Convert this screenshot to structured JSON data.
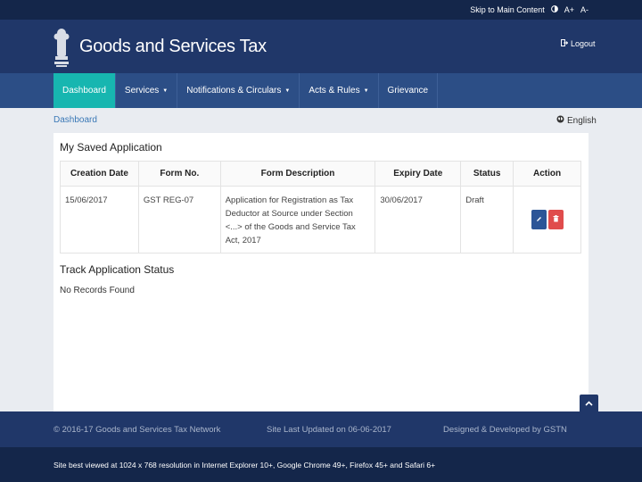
{
  "top_bar": {
    "skip_link": "Skip to Main Content",
    "contrast_icon": "contrast-icon",
    "font_increase": "A+",
    "font_decrease": "A-"
  },
  "header": {
    "title": "Goods and Services Tax",
    "logout_label": "Logout",
    "logout_icon": "logout-icon"
  },
  "nav": {
    "items": [
      {
        "label": "Dashboard",
        "active": true
      },
      {
        "label": "Services",
        "dropdown": true
      },
      {
        "label": "Notifications & Circulars",
        "dropdown": true
      },
      {
        "label": "Acts & Rules",
        "dropdown": true
      },
      {
        "label": "Grievance"
      }
    ]
  },
  "breadcrumb": {
    "label": "Dashboard"
  },
  "language": {
    "label": "English",
    "icon": "globe-icon"
  },
  "saved_application": {
    "title": "My Saved Application",
    "columns": [
      "Creation Date",
      "Form No.",
      "Form Description",
      "Expiry Date",
      "Status",
      "Action"
    ],
    "rows": [
      {
        "creation_date": "15/06/2017",
        "form_no": "GST REG-07",
        "form_description": "Application for Registration as Tax Deductor at Source under Section <...> of the Goods and Service Tax Act, 2017",
        "expiry_date": "30/06/2017",
        "status": "Draft"
      }
    ]
  },
  "track_status": {
    "title": "Track Application Status",
    "empty_text": "No Records Found"
  },
  "footer": {
    "copyright": "© 2016-17 Goods and Services Tax Network",
    "last_updated": "Site Last Updated on 06-06-2017",
    "designed_by": "Designed & Developed by GSTN",
    "best_viewed": "Site best viewed at 1024 x 768 resolution in Internet Explorer 10+, Google Chrome 49+, Firefox 45+ and Safari 6+"
  },
  "colors": {
    "top_bar": "#14264a",
    "header": "#203769",
    "nav": "#2c4e86",
    "nav_active": "#17b6b0",
    "edit_button": "#2c5597",
    "delete_button": "#e04c4c"
  }
}
